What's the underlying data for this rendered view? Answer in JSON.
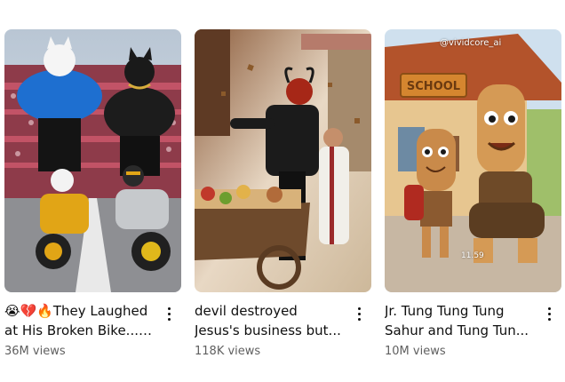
{
  "shorts": [
    {
      "title": "😭💔🔥They Laughed at His Broken Bike... ...",
      "views": "36M views",
      "thumbnail_icon": "muscular-cats-on-motorbikes-thumbnail"
    },
    {
      "title": "devil destroyed Jesus's business but...",
      "views": "118K views",
      "thumbnail_icon": "devil-and-jesus-market-thumbnail"
    },
    {
      "title": "Jr. Tung Tung Tung Sahur and Tung Tun...",
      "views": "10M views",
      "thumbnail_icon": "wooden-characters-school-thumbnail",
      "watermark": "@vividcore_ai",
      "sign_text": "SCHOOL",
      "overlay_time": "11.59"
    }
  ],
  "menu_icon": "more-vert-icon"
}
